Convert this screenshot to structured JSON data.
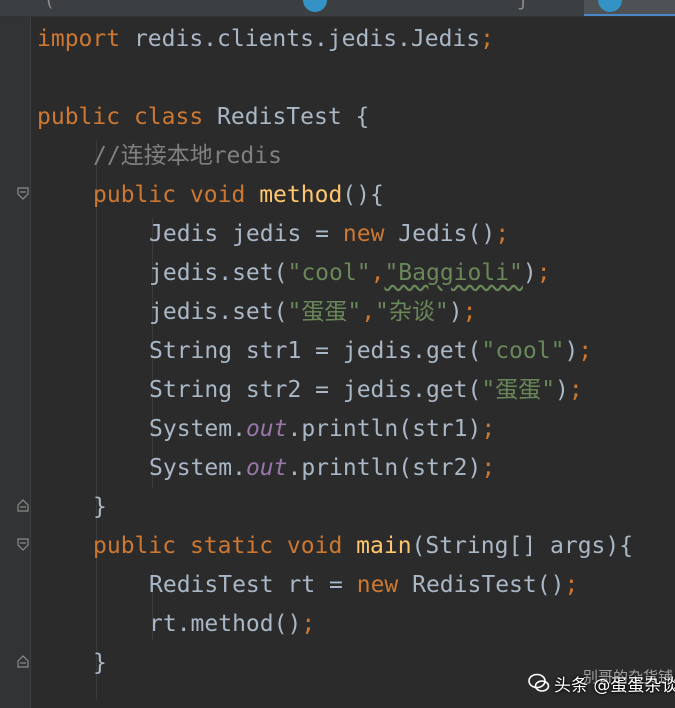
{
  "tab_bar": {
    "partial_tab_1": "(",
    "partial_tab_2": "j"
  },
  "code": {
    "import_kw": "import",
    "import_path": " redis.clients.jedis.Jedis",
    "class_modifier": "public",
    "class_kw": "class",
    "class_name": " RedisTest {",
    "comment": "//连接本地redis",
    "method_decl": {
      "public": "public",
      "void": "void",
      "name": "method",
      "rest": "(){"
    },
    "line_jedis_new": {
      "type": "Jedis jedis = ",
      "new": "new",
      "rest": " Jedis()"
    },
    "line_set1": {
      "call": "jedis.set(",
      "key": "\"cool\"",
      "comma": ",",
      "value": "\"Baggioli\"",
      "close": ")"
    },
    "line_set2": {
      "call": "jedis.set(",
      "key": "\"蛋蛋\"",
      "comma": ",",
      "value": "\"杂谈\"",
      "close": ")"
    },
    "line_get1": {
      "decl": "String str1 = jedis.get(",
      "arg": "\"cool\"",
      "close": ")"
    },
    "line_get2": {
      "decl": "String str2 = jedis.get(",
      "arg": "\"蛋蛋\"",
      "close": ")"
    },
    "line_print1": {
      "sys": "System.",
      "out": "out",
      "rest": ".println(str1)"
    },
    "line_print2": {
      "sys": "System.",
      "out": "out",
      "rest": ".println(str2)"
    },
    "method_close": "}",
    "main_decl": {
      "public": "public",
      "static": "static",
      "void": "void",
      "name": "main",
      "rest": "(String[] args){"
    },
    "line_rt_new": {
      "decl": "RedisTest rt = ",
      "new": "new",
      "rest": " RedisTest()"
    },
    "line_rt_call": "rt.method()",
    "main_close": "}",
    "semicolon": ";"
  },
  "watermark": {
    "text": "头条 @蛋蛋杂谈",
    "overlay_text": "别哥的杂货铺"
  },
  "colors": {
    "background": "#2b2b2b",
    "keyword": "#cc7832",
    "function": "#ffc66d",
    "string": "#6a8759",
    "comment": "#808080",
    "static_field": "#9876aa",
    "default_text": "#a9b7c6"
  }
}
